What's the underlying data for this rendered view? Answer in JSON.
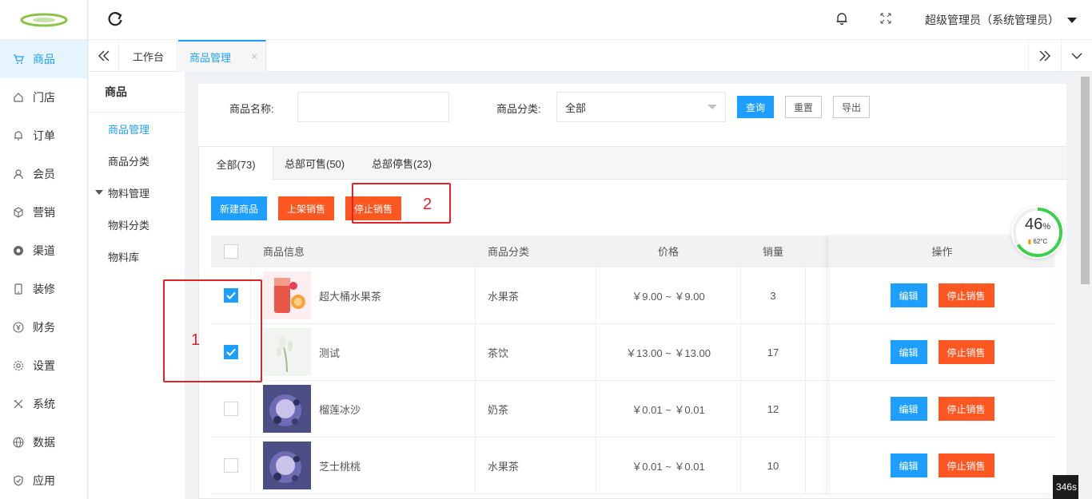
{
  "sidebar": {
    "items": [
      {
        "label": "商品",
        "icon": "cart-icon",
        "active": true
      },
      {
        "label": "门店",
        "icon": "home-icon"
      },
      {
        "label": "订单",
        "icon": "bell-icon"
      },
      {
        "label": "会员",
        "icon": "user-icon"
      },
      {
        "label": "营销",
        "icon": "cube-icon"
      },
      {
        "label": "渠道",
        "icon": "channel-icon"
      },
      {
        "label": "装修",
        "icon": "tablet-icon"
      },
      {
        "label": "财务",
        "icon": "yen-icon"
      },
      {
        "label": "设置",
        "icon": "gear-icon"
      },
      {
        "label": "系统",
        "icon": "tools-icon"
      },
      {
        "label": "数据",
        "icon": "globe-icon"
      },
      {
        "label": "应用",
        "icon": "shield-icon"
      }
    ]
  },
  "header": {
    "user": "超级管理员（系统管理员）"
  },
  "tabs": {
    "items": [
      {
        "label": "工作台"
      },
      {
        "label": "商品管理",
        "active": true
      }
    ],
    "close": "×"
  },
  "subnav": {
    "title": "商品",
    "items": [
      {
        "label": "商品管理",
        "active": true
      },
      {
        "label": "商品分类"
      },
      {
        "label": "物料管理",
        "group": true
      },
      {
        "label": "物料分类"
      },
      {
        "label": "物料库"
      }
    ]
  },
  "search": {
    "name_label": "商品名称:",
    "name_value": "",
    "category_label": "商品分类:",
    "category_value": "全部",
    "query": "查询",
    "reset": "重置",
    "export": "导出"
  },
  "panel": {
    "tabs": [
      {
        "label": "全部(73)",
        "active": true
      },
      {
        "label": "总部可售(50)"
      },
      {
        "label": "总部停售(23)"
      }
    ],
    "actions": {
      "new": "新建商品",
      "on_sale": "上架销售",
      "stop_sale": "停止销售"
    }
  },
  "table": {
    "headers": [
      "商品信息",
      "商品分类",
      "价格",
      "销量",
      "操作"
    ],
    "rows": [
      {
        "checked": true,
        "name": "超大桶水果茶",
        "category": "水果茶",
        "price": "￥9.00 ~ ￥9.00",
        "sales": "3",
        "thumb": "fruit"
      },
      {
        "checked": true,
        "name": "测试",
        "category": "茶饮",
        "price": "￥13.00 ~ ￥13.00",
        "sales": "17",
        "thumb": "flower"
      },
      {
        "checked": false,
        "name": "榴莲冰沙",
        "category": "奶茶",
        "price": "￥0.01 ~ ￥0.01",
        "sales": "12",
        "thumb": "berry"
      },
      {
        "checked": false,
        "name": "芝士桃桃",
        "category": "水果茶",
        "price": "￥0.01 ~ ￥0.01",
        "sales": "10",
        "thumb": "berry"
      }
    ],
    "edit": "编辑",
    "stop": "停止销售"
  },
  "annotations": {
    "one": "1",
    "two": "2"
  },
  "gauge": {
    "percent": "46",
    "unit": "%",
    "temp": "62°C"
  },
  "timer": "346s",
  "colors": {
    "accent": "#1e9fff",
    "danger": "#ff5722",
    "annotation": "#e02424"
  }
}
